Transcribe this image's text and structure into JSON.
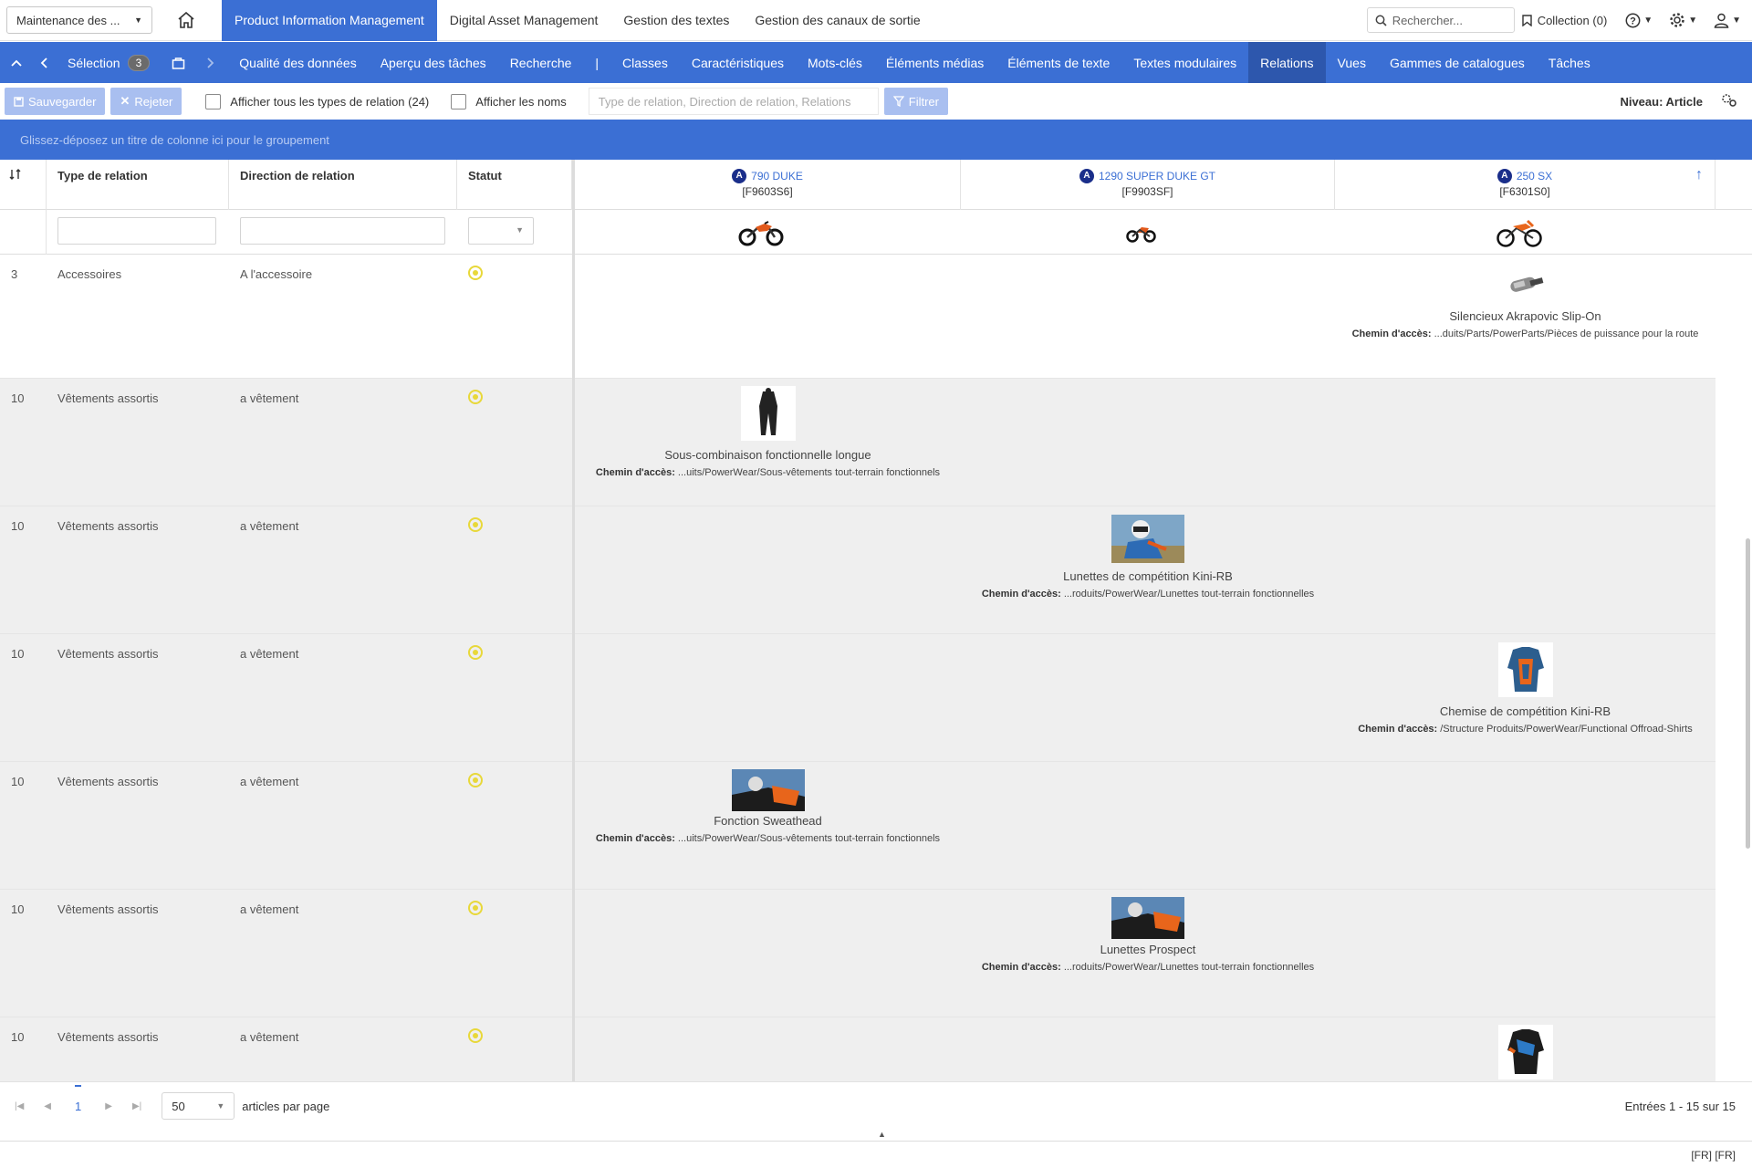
{
  "topbar": {
    "maintenance": "Maintenance des ...",
    "tabs": [
      "Product Information Management",
      "Digital Asset Management",
      "Gestion des textes",
      "Gestion des canaux de sortie"
    ],
    "search_placeholder": "Rechercher...",
    "collection": "Collection (0)"
  },
  "navbar": {
    "selection_label": "Sélection",
    "selection_count": "3",
    "items": [
      "Qualité des données",
      "Aperçu des tâches",
      "Recherche",
      "|",
      "Classes",
      "Caractéristiques",
      "Mots-clés",
      "Éléments médias",
      "Éléments de texte",
      "Textes modulaires",
      "Relations",
      "Vues",
      "Gammes de catalogues",
      "Tâches"
    ],
    "active": "Relations"
  },
  "toolbar": {
    "save": "Sauvegarder",
    "reject": "Rejeter",
    "show_all_types": "Afficher tous les types de relation (24)",
    "show_names": "Afficher les noms",
    "filter_placeholder": "Type de relation, Direction de relation, Relations",
    "filter": "Filtrer",
    "niveau": "Niveau: Article"
  },
  "groupbar": "Glissez-déposez un titre de colonne ici pour le groupement",
  "columns": {
    "type": "Type de relation",
    "direction": "Direction de relation",
    "statut": "Statut"
  },
  "products": [
    {
      "badge": "A",
      "name": "790 DUKE",
      "code": "[F9603S6]"
    },
    {
      "badge": "A",
      "name": "1290 SUPER DUKE GT",
      "code": "[F9903SF]"
    },
    {
      "badge": "A",
      "name": "250 SX",
      "code": "[F6301S0]"
    }
  ],
  "path_label": "Chemin d'accès:",
  "rows": [
    {
      "count": "3",
      "type": "Accessoires",
      "direction": "A l'accessoire",
      "item": "Silencieux Akrapovic Slip-On",
      "path": "...duits/Parts/PowerParts/Pièces de puissance pour la route"
    },
    {
      "count": "10",
      "type": "Vêtements assortis",
      "direction": "a vêtement",
      "item": "Sous-combinaison fonctionnelle longue",
      "path": "...uits/PowerWear/Sous-vêtements tout-terrain fonctionnels"
    },
    {
      "count": "10",
      "type": "Vêtements assortis",
      "direction": "a vêtement",
      "item": "Lunettes de compétition Kini-RB",
      "path": "...roduits/PowerWear/Lunettes tout-terrain fonctionnelles"
    },
    {
      "count": "10",
      "type": "Vêtements assortis",
      "direction": "a vêtement",
      "item": "Chemise de compétition Kini-RB",
      "path": "/Structure Produits/PowerWear/Functional Offroad-Shirts"
    },
    {
      "count": "10",
      "type": "Vêtements assortis",
      "direction": "a vêtement",
      "item": "Fonction Sweathead",
      "path": "...uits/PowerWear/Sous-vêtements tout-terrain fonctionnels"
    },
    {
      "count": "10",
      "type": "Vêtements assortis",
      "direction": "a vêtement",
      "item": "Lunettes Prospect",
      "path": "...roduits/PowerWear/Lunettes tout-terrain fonctionnelles"
    },
    {
      "count": "10",
      "type": "Vêtements assortis",
      "direction": "a vêtement"
    }
  ],
  "footer": {
    "page": "1",
    "per_page": "50",
    "per_page_label": "articles par page",
    "entries": "Entrées 1 - 15 sur 15"
  },
  "statusbar": "[FR] [FR]"
}
